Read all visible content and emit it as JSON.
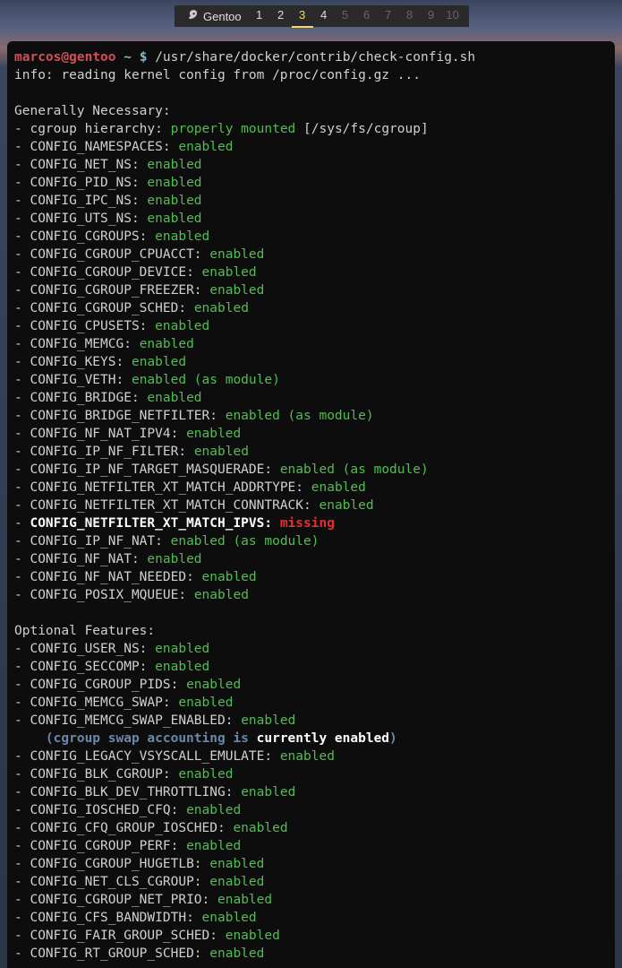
{
  "tabbar": {
    "title": "Gentoo",
    "tabs": [
      {
        "n": "1",
        "state": "avail"
      },
      {
        "n": "2",
        "state": "avail"
      },
      {
        "n": "3",
        "state": "active"
      },
      {
        "n": "4",
        "state": "avail"
      },
      {
        "n": "5",
        "state": "dim"
      },
      {
        "n": "6",
        "state": "dim"
      },
      {
        "n": "7",
        "state": "dim"
      },
      {
        "n": "8",
        "state": "dim"
      },
      {
        "n": "9",
        "state": "dim"
      },
      {
        "n": "10",
        "state": "dim"
      }
    ]
  },
  "prompt": {
    "user": "marcos",
    "host": "gentoo",
    "path": "~",
    "symbol": "$",
    "command": "/usr/share/docker/contrib/check-config.sh"
  },
  "info_line": "info: reading kernel config from /proc/config.gz ...",
  "sections": [
    {
      "title": "Generally Necessary:",
      "lines": [
        {
          "label": "cgroup hierarchy:",
          "status": "properly mounted",
          "status_class": "ok",
          "extra": " [/sys/fs/cgroup]"
        },
        {
          "label": "CONFIG_NAMESPACES:",
          "status": "enabled",
          "status_class": "ok"
        },
        {
          "label": "CONFIG_NET_NS:",
          "status": "enabled",
          "status_class": "ok"
        },
        {
          "label": "CONFIG_PID_NS:",
          "status": "enabled",
          "status_class": "ok"
        },
        {
          "label": "CONFIG_IPC_NS:",
          "status": "enabled",
          "status_class": "ok"
        },
        {
          "label": "CONFIG_UTS_NS:",
          "status": "enabled",
          "status_class": "ok"
        },
        {
          "label": "CONFIG_CGROUPS:",
          "status": "enabled",
          "status_class": "ok"
        },
        {
          "label": "CONFIG_CGROUP_CPUACCT:",
          "status": "enabled",
          "status_class": "ok"
        },
        {
          "label": "CONFIG_CGROUP_DEVICE:",
          "status": "enabled",
          "status_class": "ok"
        },
        {
          "label": "CONFIG_CGROUP_FREEZER:",
          "status": "enabled",
          "status_class": "ok"
        },
        {
          "label": "CONFIG_CGROUP_SCHED:",
          "status": "enabled",
          "status_class": "ok"
        },
        {
          "label": "CONFIG_CPUSETS:",
          "status": "enabled",
          "status_class": "ok"
        },
        {
          "label": "CONFIG_MEMCG:",
          "status": "enabled",
          "status_class": "ok"
        },
        {
          "label": "CONFIG_KEYS:",
          "status": "enabled",
          "status_class": "ok"
        },
        {
          "label": "CONFIG_VETH:",
          "status": "enabled (as module)",
          "status_class": "ok"
        },
        {
          "label": "CONFIG_BRIDGE:",
          "status": "enabled",
          "status_class": "ok"
        },
        {
          "label": "CONFIG_BRIDGE_NETFILTER:",
          "status": "enabled (as module)",
          "status_class": "ok"
        },
        {
          "label": "CONFIG_NF_NAT_IPV4:",
          "status": "enabled",
          "status_class": "ok"
        },
        {
          "label": "CONFIG_IP_NF_FILTER:",
          "status": "enabled",
          "status_class": "ok"
        },
        {
          "label": "CONFIG_IP_NF_TARGET_MASQUERADE:",
          "status": "enabled (as module)",
          "status_class": "ok"
        },
        {
          "label": "CONFIG_NETFILTER_XT_MATCH_ADDRTYPE:",
          "status": "enabled",
          "status_class": "ok"
        },
        {
          "label": "CONFIG_NETFILTER_XT_MATCH_CONNTRACK:",
          "status": "enabled",
          "status_class": "ok"
        },
        {
          "label": "CONFIG_NETFILTER_XT_MATCH_IPVS:",
          "status": "missing",
          "status_class": "miss",
          "bold_label": true
        },
        {
          "label": "CONFIG_IP_NF_NAT:",
          "status": "enabled (as module)",
          "status_class": "ok"
        },
        {
          "label": "CONFIG_NF_NAT:",
          "status": "enabled",
          "status_class": "ok"
        },
        {
          "label": "CONFIG_NF_NAT_NEEDED:",
          "status": "enabled",
          "status_class": "ok"
        },
        {
          "label": "CONFIG_POSIX_MQUEUE:",
          "status": "enabled",
          "status_class": "ok"
        }
      ]
    },
    {
      "title": "Optional Features:",
      "lines": [
        {
          "label": "CONFIG_USER_NS:",
          "status": "enabled",
          "status_class": "ok"
        },
        {
          "label": "CONFIG_SECCOMP:",
          "status": "enabled",
          "status_class": "ok"
        },
        {
          "label": "CONFIG_CGROUP_PIDS:",
          "status": "enabled",
          "status_class": "ok"
        },
        {
          "label": "CONFIG_MEMCG_SWAP:",
          "status": "enabled",
          "status_class": "ok"
        },
        {
          "label": "CONFIG_MEMCG_SWAP_ENABLED:",
          "status": "enabled",
          "status_class": "ok",
          "note": "    (cgroup swap accounting is currently enabled)",
          "note_bold": "currently enabled"
        },
        {
          "label": "CONFIG_LEGACY_VSYSCALL_EMULATE:",
          "status": "enabled",
          "status_class": "ok"
        },
        {
          "label": "CONFIG_BLK_CGROUP:",
          "status": "enabled",
          "status_class": "ok"
        },
        {
          "label": "CONFIG_BLK_DEV_THROTTLING:",
          "status": "enabled",
          "status_class": "ok"
        },
        {
          "label": "CONFIG_IOSCHED_CFQ:",
          "status": "enabled",
          "status_class": "ok"
        },
        {
          "label": "CONFIG_CFQ_GROUP_IOSCHED:",
          "status": "enabled",
          "status_class": "ok"
        },
        {
          "label": "CONFIG_CGROUP_PERF:",
          "status": "enabled",
          "status_class": "ok"
        },
        {
          "label": "CONFIG_CGROUP_HUGETLB:",
          "status": "enabled",
          "status_class": "ok"
        },
        {
          "label": "CONFIG_NET_CLS_CGROUP:",
          "status": "enabled",
          "status_class": "ok"
        },
        {
          "label": "CONFIG_CGROUP_NET_PRIO:",
          "status": "enabled",
          "status_class": "ok"
        },
        {
          "label": "CONFIG_CFS_BANDWIDTH:",
          "status": "enabled",
          "status_class": "ok"
        },
        {
          "label": "CONFIG_FAIR_GROUP_SCHED:",
          "status": "enabled",
          "status_class": "ok"
        },
        {
          "label": "CONFIG_RT_GROUP_SCHED:",
          "status": "enabled",
          "status_class": "ok"
        }
      ]
    }
  ]
}
